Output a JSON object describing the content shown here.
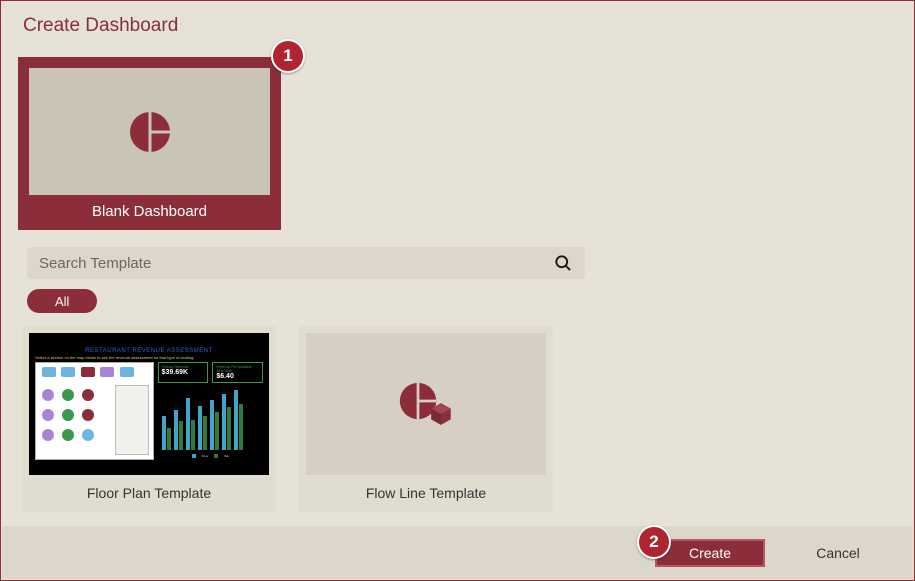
{
  "dialog": {
    "title": "Create Dashboard"
  },
  "blank": {
    "label": "Blank Dashboard"
  },
  "search": {
    "placeholder": "Search Template"
  },
  "filter": {
    "all_label": "All"
  },
  "templates": [
    {
      "label": "Floor Plan Template"
    },
    {
      "label": "Flow Line Template"
    }
  ],
  "floor_preview": {
    "title": "RESTAURANT REVENUE ASSESSMENT",
    "subtitle": "Select a section on the map below to see the revenue assessment for that type of seating.",
    "kpis": [
      {
        "label": "Primary Revenue",
        "value": "$39.69K"
      },
      {
        "label": "Revenue Per Available Seat Hour",
        "value": "$6.40"
      }
    ],
    "legend": [
      "Floor",
      "Bar"
    ]
  },
  "buttons": {
    "create": "Create",
    "cancel": "Cancel"
  },
  "callouts": {
    "one": "1",
    "two": "2"
  },
  "colors": {
    "accent": "#8b2e3a",
    "bg": "#e7e2d7",
    "callout": "#b02331"
  }
}
